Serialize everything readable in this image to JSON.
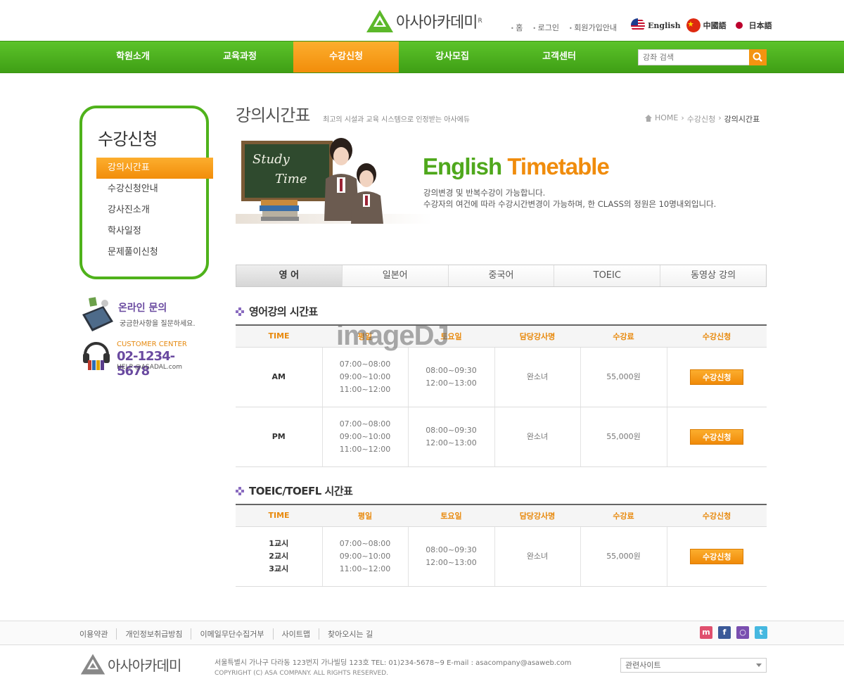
{
  "header": {
    "logo_text": "아사아카데미",
    "logo_mark": "R",
    "links": [
      "홈",
      "로그인",
      "회원가입안내"
    ],
    "languages": [
      {
        "label": "English",
        "icon": "us-flag-icon"
      },
      {
        "label": "中國語",
        "icon": "china-flag-icon"
      },
      {
        "label": "日本語",
        "icon": "japan-flag-icon"
      }
    ]
  },
  "nav": {
    "items": [
      "학원소개",
      "교육과정",
      "수강신청",
      "강사모집",
      "고객센터"
    ],
    "active_index": 2,
    "search_placeholder": "강좌 검색"
  },
  "sidebar": {
    "title": "수강신청",
    "items": [
      "강의시간표",
      "수강신청안내",
      "강사진소개",
      "학사일정",
      "문제풀이신청"
    ],
    "online": {
      "title": "온라인 문의",
      "sub": "궁금한사항을 질문하세요."
    },
    "customer": {
      "label": "CUSTOMER CENTER",
      "phone": "02-1234-5678",
      "email": "HELP @ASADAL.com"
    }
  },
  "main": {
    "title": "강의시간표",
    "subtitle": "최고의 시설과 교육 시스템으로 인정받는 아사에듀",
    "breadcrumb": [
      "HOME",
      "수강신청",
      "강의시간표"
    ],
    "banner": {
      "chalk_line1": "Study",
      "chalk_line2": "Time",
      "title_part1": "English",
      "title_part2": "Timetable",
      "desc_line1": "강의변경 및 반복수강이 가능합니다.",
      "desc_line2": "수강자의 여건에 따라  수강시간변경이 가능하며, 한 CLASS의 정원은 10명내외입니다."
    },
    "tabs": [
      "영 어",
      "일본어",
      "중국어",
      "TOEIC",
      "동영상 강의"
    ],
    "watermark": "imageDJ",
    "section1": {
      "title": "영어강의 시간표",
      "headers": [
        "TIME",
        "평일",
        "토요일",
        "담당강사명",
        "수강료",
        "수강신청"
      ],
      "rows": [
        {
          "time": "AM",
          "weekday": [
            "07:00~08:00",
            "09:00~10:00",
            "11:00~12:00"
          ],
          "saturday": [
            "08:00~09:30",
            "12:00~13:00"
          ],
          "teacher": "완소녀",
          "fee": "55,000원",
          "button": "수강신청"
        },
        {
          "time": "PM",
          "weekday": [
            "07:00~08:00",
            "09:00~10:00",
            "11:00~12:00"
          ],
          "saturday": [
            "08:00~09:30",
            "12:00~13:00"
          ],
          "teacher": "완소녀",
          "fee": "55,000원",
          "button": "수강신청"
        }
      ]
    },
    "section2": {
      "title": "TOEIC/TOEFL 시간표",
      "headers": [
        "TIME",
        "평일",
        "토요일",
        "담당강사명",
        "수강료",
        "수강신청"
      ],
      "rows": [
        {
          "time": [
            "1교시",
            "2교시",
            "3교시"
          ],
          "weekday": [
            "07:00~08:00",
            "09:00~10:00",
            "11:00~12:00"
          ],
          "saturday": [
            "08:00~09:30",
            "12:00~13:00"
          ],
          "teacher": "완소녀",
          "fee": "55,000원",
          "button": "수강신청"
        }
      ]
    }
  },
  "footer": {
    "links": [
      "이용약관",
      "개인정보취급방침",
      "이메일무단수집거부",
      "사이트맵",
      "찾아오시는 길"
    ],
    "logo_text": "아사아카데미",
    "address": "서울특별시 가나구 다라동  123번지 가나빌딩 123호    TEL: 01)234-5678~9    E-mail : asacompany@asaweb.com",
    "copyright": "COPYRIGHT (C) ASA COMPANY. ALL RIGHTS RESERVED.",
    "related_select": "관련사이트"
  },
  "colors": {
    "green": "#4fb21b",
    "orange": "#f39410",
    "purple": "#6a4aa0"
  }
}
